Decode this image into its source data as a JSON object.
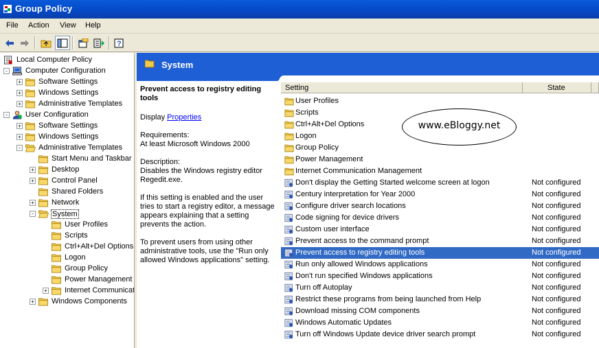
{
  "window": {
    "title": "Group Policy"
  },
  "menu": [
    "File",
    "Action",
    "View",
    "Help"
  ],
  "tree": [
    {
      "label": "Local Computer Policy",
      "icon": "policy-icon"
    },
    {
      "label": "Computer Configuration",
      "icon": "computer-icon"
    },
    {
      "label": "Software Settings",
      "icon": "folder-icon"
    },
    {
      "label": "Windows Settings",
      "icon": "folder-icon"
    },
    {
      "label": "Administrative Templates",
      "icon": "folder-icon"
    },
    {
      "label": "User Configuration",
      "icon": "user-icon"
    },
    {
      "label": "Software Settings",
      "icon": "folder-icon"
    },
    {
      "label": "Windows Settings",
      "icon": "folder-icon"
    },
    {
      "label": "Administrative Templates",
      "icon": "folder-open-icon"
    },
    {
      "label": "Start Menu and Taskbar",
      "icon": "folder-icon"
    },
    {
      "label": "Desktop",
      "icon": "folder-icon"
    },
    {
      "label": "Control Panel",
      "icon": "folder-icon"
    },
    {
      "label": "Shared Folders",
      "icon": "folder-icon"
    },
    {
      "label": "Network",
      "icon": "folder-icon"
    },
    {
      "label": "System",
      "icon": "folder-open-icon"
    },
    {
      "label": "User Profiles",
      "icon": "folder-icon"
    },
    {
      "label": "Scripts",
      "icon": "folder-icon"
    },
    {
      "label": "Ctrl+Alt+Del Options",
      "icon": "folder-icon"
    },
    {
      "label": "Logon",
      "icon": "folder-icon"
    },
    {
      "label": "Group Policy",
      "icon": "folder-icon"
    },
    {
      "label": "Power Management",
      "icon": "folder-icon"
    },
    {
      "label": "Internet Communication Management",
      "icon": "folder-icon"
    },
    {
      "label": "Windows Components",
      "icon": "folder-icon"
    }
  ],
  "header": {
    "title": "System"
  },
  "description": {
    "heading": "Prevent access to registry editing tools",
    "display_label": "Display",
    "properties_link": "Properties",
    "requirements": "Requirements:",
    "requirements_value": "At least Microsoft Windows 2000",
    "description_label": "Description:",
    "description_text": "Disables the Windows registry editor Regedit.exe.",
    "para1": "If this setting is enabled and the user tries to start a registry editor, a message appears explaining that a setting prevents the action.",
    "para2": "To prevent users from using other administrative tools, use the \"Run only allowed Windows applications\" setting."
  },
  "list": {
    "columns": {
      "setting": "Setting",
      "state": "State"
    },
    "folders": [
      "User Profiles",
      "Scripts",
      "Ctrl+Alt+Del Options",
      "Logon",
      "Group Policy",
      "Power Management",
      "Internet Communication Management"
    ],
    "settings": [
      {
        "name": "Don't display the Getting Started welcome screen at logon",
        "state": "Not configured"
      },
      {
        "name": "Century interpretation for Year 2000",
        "state": "Not configured"
      },
      {
        "name": "Configure driver search locations",
        "state": "Not configured"
      },
      {
        "name": "Code signing for device drivers",
        "state": "Not configured"
      },
      {
        "name": "Custom user interface",
        "state": "Not configured"
      },
      {
        "name": "Prevent access to the command prompt",
        "state": "Not configured"
      },
      {
        "name": "Prevent access to registry editing tools",
        "state": "Not configured",
        "selected": true
      },
      {
        "name": "Run only allowed Windows applications",
        "state": "Not configured"
      },
      {
        "name": "Don't run specified Windows applications",
        "state": "Not configured"
      },
      {
        "name": "Turn off Autoplay",
        "state": "Not configured"
      },
      {
        "name": "Restrict these programs from being launched from Help",
        "state": "Not configured"
      },
      {
        "name": "Download missing COM components",
        "state": "Not configured"
      },
      {
        "name": "Windows Automatic Updates",
        "state": "Not configured"
      },
      {
        "name": "Turn off Windows Update device driver search prompt",
        "state": "Not configured"
      }
    ]
  },
  "watermark": "www.eBloggy.net",
  "colors": {
    "title_bar": "#0548c6",
    "header_band": "#1f5fd6",
    "selection": "#316ac5",
    "folder": "#f2c948"
  }
}
